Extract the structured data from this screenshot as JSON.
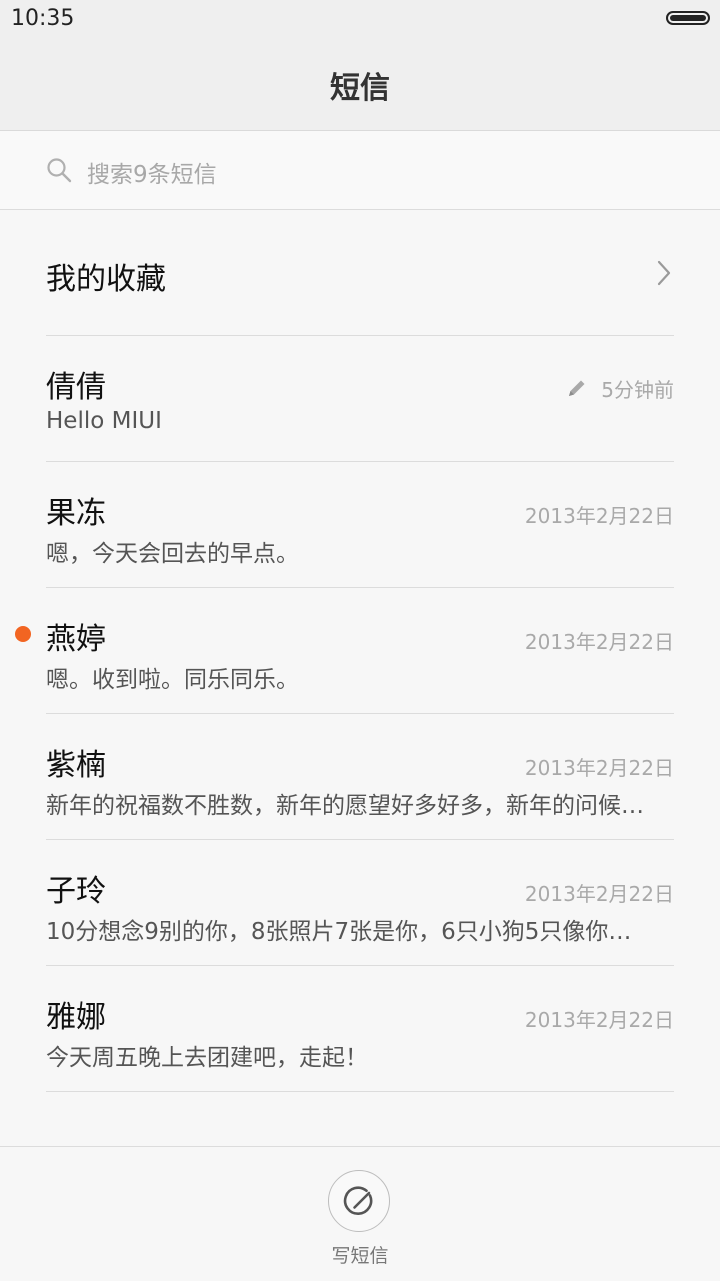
{
  "status_bar": {
    "time": "10:35"
  },
  "header": {
    "title": "短信"
  },
  "search": {
    "placeholder": "搜索9条短信"
  },
  "favorites": {
    "label": "我的收藏"
  },
  "threads": [
    {
      "name": "倩倩",
      "preview": "Hello MIUI",
      "date": "5分钟前",
      "draft": true,
      "unread": false
    },
    {
      "name": "果冻",
      "preview": "嗯，今天会回去的早点。",
      "date": "2013年2月22日",
      "draft": false,
      "unread": false
    },
    {
      "name": "燕婷",
      "preview": "嗯。收到啦。同乐同乐。",
      "date": "2013年2月22日",
      "draft": false,
      "unread": true
    },
    {
      "name": "紫楠",
      "preview": "新年的祝福数不胜数，新年的愿望好多好多，新年的问候…",
      "date": "2013年2月22日",
      "draft": false,
      "unread": false
    },
    {
      "name": "子玲",
      "preview": "10分想念9别的你，8张照片7张是你，6只小狗5只像你…",
      "date": "2013年2月22日",
      "draft": false,
      "unread": false
    },
    {
      "name": "雅娜",
      "preview": "今天周五晚上去团建吧，走起！",
      "date": "2013年2月22日",
      "draft": false,
      "unread": false
    }
  ],
  "compose": {
    "label": "写短信"
  },
  "colors": {
    "unread_dot": "#f26522"
  }
}
